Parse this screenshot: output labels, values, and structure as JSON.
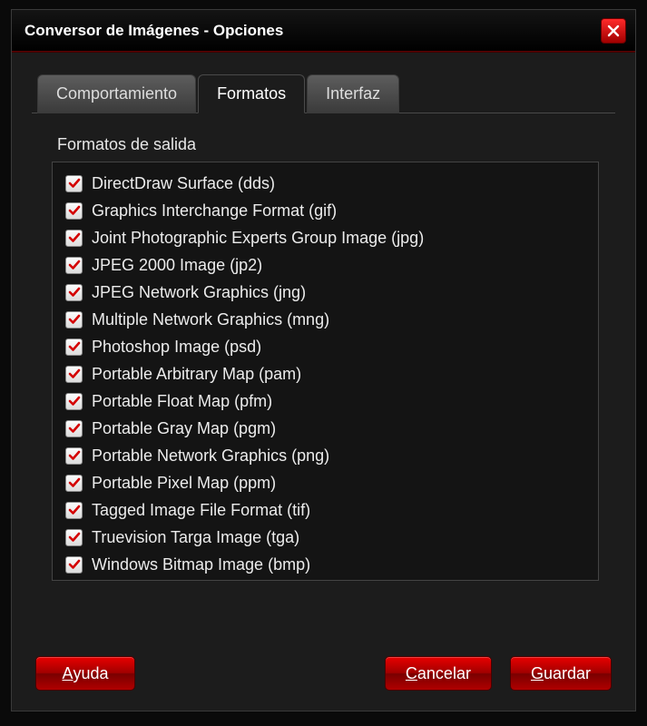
{
  "window": {
    "title": "Conversor de Imágenes - Opciones"
  },
  "tabs": {
    "behaviour": "Comportamiento",
    "formats": "Formatos",
    "interface": "Interfaz",
    "active": "formats"
  },
  "section": {
    "output_formats_title": "Formatos de salida"
  },
  "formats": [
    {
      "checked": true,
      "label": "DirectDraw Surface (dds)"
    },
    {
      "checked": true,
      "label": "Graphics Interchange Format (gif)"
    },
    {
      "checked": true,
      "label": "Joint Photographic Experts Group Image (jpg)"
    },
    {
      "checked": true,
      "label": "JPEG 2000 Image (jp2)"
    },
    {
      "checked": true,
      "label": "JPEG Network Graphics (jng)"
    },
    {
      "checked": true,
      "label": "Multiple Network Graphics (mng)"
    },
    {
      "checked": true,
      "label": "Photoshop Image (psd)"
    },
    {
      "checked": true,
      "label": "Portable Arbitrary Map (pam)"
    },
    {
      "checked": true,
      "label": "Portable Float Map (pfm)"
    },
    {
      "checked": true,
      "label": "Portable Gray Map (pgm)"
    },
    {
      "checked": true,
      "label": "Portable Network Graphics (png)"
    },
    {
      "checked": true,
      "label": "Portable Pixel Map (ppm)"
    },
    {
      "checked": true,
      "label": "Tagged Image File Format (tif)"
    },
    {
      "checked": true,
      "label": "Truevision Targa Image (tga)"
    },
    {
      "checked": true,
      "label": "Windows Bitmap Image (bmp)"
    }
  ],
  "buttons": {
    "help_accel": "A",
    "help_rest": "yuda",
    "cancel_accel": "C",
    "cancel_rest": "ancelar",
    "save_accel": "G",
    "save_rest": "uardar"
  },
  "colors": {
    "accent": "#d40000",
    "checkmark": "#d40000"
  }
}
